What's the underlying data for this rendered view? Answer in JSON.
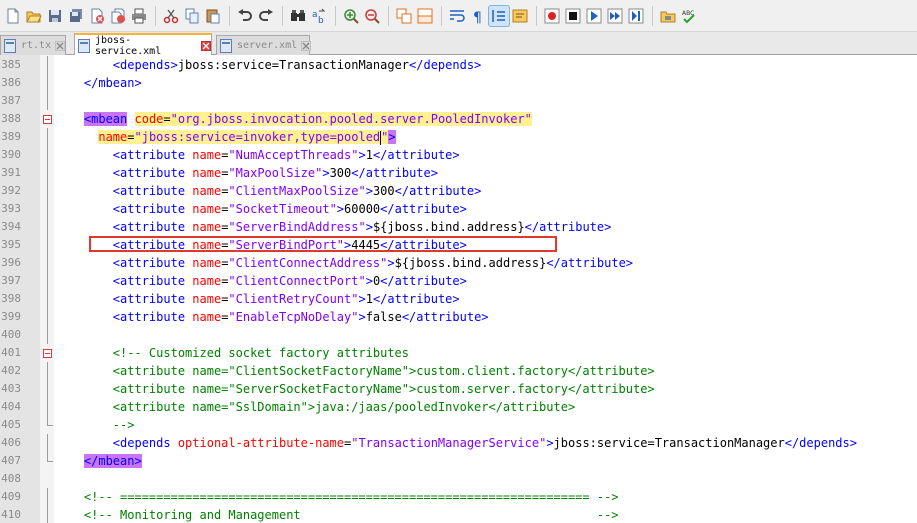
{
  "tabs": [
    {
      "label": "rt.tx",
      "active": false
    },
    {
      "label": "jboss-service.xml",
      "active": true
    },
    {
      "label": "server.xml",
      "active": false
    }
  ],
  "toolbar_icons": [
    "new-file-icon",
    "open-file-icon",
    "save-icon",
    "save-all-icon",
    "close-icon",
    "close-all-icon",
    "print-icon",
    "cut-icon",
    "copy-icon",
    "paste-icon",
    "undo-icon",
    "redo-icon",
    "find-icon",
    "replace-icon",
    "zoom-in-icon",
    "zoom-out-icon",
    "sync-vertical-icon",
    "sync-horizontal-icon",
    "word-wrap-icon",
    "show-all-chars-icon",
    "indent-guide-icon",
    "user-language-icon",
    "record-macro-icon",
    "stop-macro-icon",
    "play-macro-icon",
    "run-macro-multiple-icon",
    "save-macro-icon",
    "open-folder-icon",
    "spellcheck-icon"
  ],
  "lines": [
    {
      "num": "385",
      "segs": [
        [
          "t",
          "        <depends>"
        ],
        [
          "tx",
          "jboss:service=TransactionManager"
        ],
        [
          "t",
          "</depends>"
        ]
      ]
    },
    {
      "num": "386",
      "segs": [
        [
          "t",
          "    </mbean>"
        ]
      ]
    },
    {
      "num": "387",
      "segs": []
    },
    {
      "num": "388",
      "segs": [
        [
          "t",
          "    "
        ],
        [
          "t hl-tag",
          "<mbean"
        ],
        [
          "tx",
          " "
        ],
        [
          "an hl-sel",
          "code"
        ],
        [
          "tx hl-sel",
          "="
        ],
        [
          "av hl-sel",
          "\"org.jboss.invocation.pooled.server.PooledInvoker\""
        ]
      ]
    },
    {
      "num": "389",
      "segs": [
        [
          "tx",
          "      "
        ],
        [
          "an hl-sel",
          "name"
        ],
        [
          "tx hl-sel",
          "="
        ],
        [
          "av hl-sel",
          "\"jboss:service=invoker,type=pooled"
        ],
        [
          "caret",
          ""
        ],
        [
          "av hl-sel",
          "\""
        ],
        [
          "t hl-tag",
          ">"
        ]
      ]
    },
    {
      "num": "390",
      "segs": [
        [
          "t",
          "        <attribute "
        ],
        [
          "an",
          "name"
        ],
        [
          "tx",
          "="
        ],
        [
          "av",
          "\"NumAcceptThreads\""
        ],
        [
          "t",
          ">"
        ],
        [
          "tx",
          "1"
        ],
        [
          "t",
          "</attribute>"
        ]
      ]
    },
    {
      "num": "391",
      "segs": [
        [
          "t",
          "        <attribute "
        ],
        [
          "an",
          "name"
        ],
        [
          "tx",
          "="
        ],
        [
          "av",
          "\"MaxPoolSize\""
        ],
        [
          "t",
          ">"
        ],
        [
          "tx",
          "300"
        ],
        [
          "t",
          "</attribute>"
        ]
      ]
    },
    {
      "num": "392",
      "segs": [
        [
          "t",
          "        <attribute "
        ],
        [
          "an",
          "name"
        ],
        [
          "tx",
          "="
        ],
        [
          "av",
          "\"ClientMaxPoolSize\""
        ],
        [
          "t",
          ">"
        ],
        [
          "tx",
          "300"
        ],
        [
          "t",
          "</attribute>"
        ]
      ]
    },
    {
      "num": "393",
      "segs": [
        [
          "t",
          "        <attribute "
        ],
        [
          "an",
          "name"
        ],
        [
          "tx",
          "="
        ],
        [
          "av",
          "\"SocketTimeout\""
        ],
        [
          "t",
          ">"
        ],
        [
          "tx",
          "60000"
        ],
        [
          "t",
          "</attribute>"
        ]
      ]
    },
    {
      "num": "394",
      "segs": [
        [
          "t",
          "        <attribute "
        ],
        [
          "an",
          "name"
        ],
        [
          "tx",
          "="
        ],
        [
          "av",
          "\"ServerBindAddress\""
        ],
        [
          "t",
          ">"
        ],
        [
          "tx",
          "${jboss.bind.address}"
        ],
        [
          "t",
          "</attribute>"
        ]
      ]
    },
    {
      "num": "395",
      "segs": [
        [
          "t",
          "        <attribute "
        ],
        [
          "an",
          "name"
        ],
        [
          "tx",
          "="
        ],
        [
          "av",
          "\"ServerBindPort\""
        ],
        [
          "t",
          ">"
        ],
        [
          "tx",
          "4445"
        ],
        [
          "t",
          "</attribute>"
        ]
      ]
    },
    {
      "num": "396",
      "segs": [
        [
          "t",
          "        <attribute "
        ],
        [
          "an",
          "name"
        ],
        [
          "tx",
          "="
        ],
        [
          "av",
          "\"ClientConnectAddress\""
        ],
        [
          "t",
          ">"
        ],
        [
          "tx",
          "${jboss.bind.address}"
        ],
        [
          "t",
          "</attribute>"
        ]
      ]
    },
    {
      "num": "397",
      "segs": [
        [
          "t",
          "        <attribute "
        ],
        [
          "an",
          "name"
        ],
        [
          "tx",
          "="
        ],
        [
          "av",
          "\"ClientConnectPort\""
        ],
        [
          "t",
          ">"
        ],
        [
          "tx",
          "0"
        ],
        [
          "t",
          "</attribute>"
        ]
      ]
    },
    {
      "num": "398",
      "segs": [
        [
          "t",
          "        <attribute "
        ],
        [
          "an",
          "name"
        ],
        [
          "tx",
          "="
        ],
        [
          "av",
          "\"ClientRetryCount\""
        ],
        [
          "t",
          ">"
        ],
        [
          "tx",
          "1"
        ],
        [
          "t",
          "</attribute>"
        ]
      ]
    },
    {
      "num": "399",
      "segs": [
        [
          "t",
          "        <attribute "
        ],
        [
          "an",
          "name"
        ],
        [
          "tx",
          "="
        ],
        [
          "av",
          "\"EnableTcpNoDelay\""
        ],
        [
          "t",
          ">"
        ],
        [
          "tx",
          "false"
        ],
        [
          "t",
          "</attribute>"
        ]
      ]
    },
    {
      "num": "400",
      "segs": []
    },
    {
      "num": "401",
      "segs": [
        [
          "cm",
          "        <!-- Customized socket factory attributes"
        ]
      ]
    },
    {
      "num": "402",
      "segs": [
        [
          "cm",
          "        <attribute name=\"ClientSocketFactoryName\">custom.client.factory</attribute>"
        ]
      ]
    },
    {
      "num": "403",
      "segs": [
        [
          "cm",
          "        <attribute name=\"ServerSocketFactoryName\">custom.server.factory</attribute>"
        ]
      ]
    },
    {
      "num": "404",
      "segs": [
        [
          "cm",
          "        <attribute name=\"SslDomain\">java:/jaas/pooledInvoker</attribute>"
        ]
      ]
    },
    {
      "num": "405",
      "segs": [
        [
          "cm",
          "        -->"
        ]
      ]
    },
    {
      "num": "406",
      "segs": [
        [
          "t",
          "        <depends "
        ],
        [
          "an",
          "optional-attribute-name"
        ],
        [
          "tx",
          "="
        ],
        [
          "av",
          "\"TransactionManagerService\""
        ],
        [
          "t",
          ">"
        ],
        [
          "tx",
          "jboss:service=TransactionManager"
        ],
        [
          "t",
          "</depends>"
        ]
      ]
    },
    {
      "num": "407",
      "segs": [
        [
          "t",
          "    "
        ],
        [
          "t hl-tag",
          "</mbean>"
        ]
      ]
    },
    {
      "num": "408",
      "segs": []
    },
    {
      "num": "409",
      "segs": [
        [
          "cm",
          "    <!-- ================================================================= -->"
        ]
      ]
    },
    {
      "num": "410",
      "segs": [
        [
          "cm",
          "    <!-- Monitoring and Management                                         -->"
        ]
      ]
    }
  ]
}
